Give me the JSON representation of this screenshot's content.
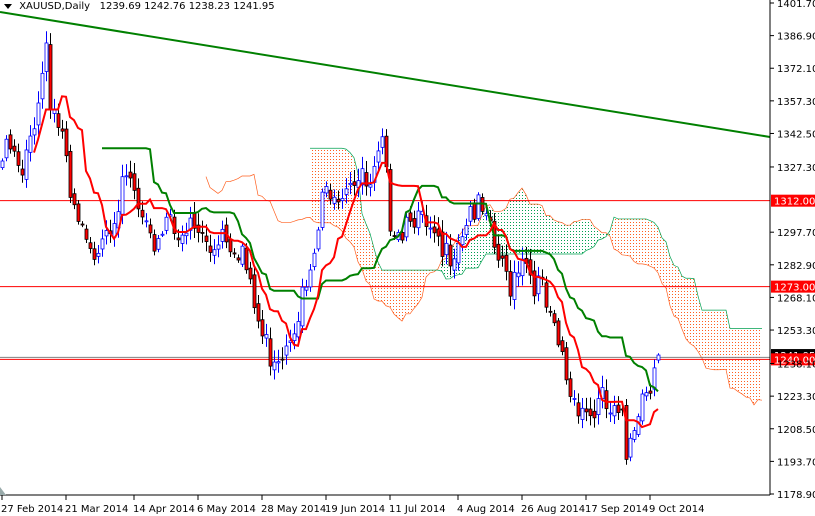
{
  "header": {
    "symbol": "XAUUSD,Daily",
    "open": "1239.69",
    "high": "1242.76",
    "low": "1238.23",
    "close": "1241.95"
  },
  "chart_data": {
    "type": "candlestick",
    "title": "XAUUSD,Daily",
    "ylim": [
      1178.9,
      1401.7
    ],
    "y_ticks": [
      "1401.70",
      "1386.90",
      "1372.10",
      "1357.30",
      "1342.50",
      "1327.30",
      "1312.00",
      "1297.70",
      "1282.90",
      "1273.00",
      "1268.10",
      "1253.30",
      "1241.95",
      "1240.00",
      "1238.10",
      "1223.30",
      "1208.50",
      "1193.70",
      "1178.90"
    ],
    "x_ticks": [
      {
        "bar": 0,
        "label": "27 Feb 2014"
      },
      {
        "bar": 16,
        "label": "21 Mar 2014"
      },
      {
        "bar": 33,
        "label": "14 Apr 2014"
      },
      {
        "bar": 49,
        "label": "6 May 2014"
      },
      {
        "bar": 65,
        "label": "28 May 2014"
      },
      {
        "bar": 81,
        "label": "19 Jun 2014"
      },
      {
        "bar": 97,
        "label": "11 Jul 2014"
      },
      {
        "bar": 114,
        "label": "4 Aug 2014"
      },
      {
        "bar": 130,
        "label": "26 Aug 2014"
      },
      {
        "bar": 146,
        "label": "17 Sep 2014"
      },
      {
        "bar": 162,
        "label": "9 Oct 2014"
      }
    ],
    "close_keyframes": [
      [
        0,
        1330
      ],
      [
        2,
        1335
      ],
      [
        5,
        1320
      ],
      [
        7,
        1340
      ],
      [
        10,
        1370
      ],
      [
        11,
        1385
      ],
      [
        12,
        1360
      ],
      [
        15,
        1340
      ],
      [
        17,
        1310
      ],
      [
        20,
        1295
      ],
      [
        22,
        1285
      ],
      [
        25,
        1300
      ],
      [
        27,
        1305
      ],
      [
        30,
        1315
      ],
      [
        32,
        1320
      ],
      [
        35,
        1300
      ],
      [
        37,
        1290
      ],
      [
        40,
        1300
      ],
      [
        42,
        1310
      ],
      [
        45,
        1290
      ],
      [
        47,
        1300
      ],
      [
        50,
        1295
      ],
      [
        52,
        1290
      ],
      [
        55,
        1300
      ],
      [
        57,
        1295
      ],
      [
        60,
        1290
      ],
      [
        62,
        1270
      ],
      [
        65,
        1250
      ],
      [
        67,
        1243
      ],
      [
        70,
        1245
      ],
      [
        72,
        1255
      ],
      [
        75,
        1268
      ],
      [
        77,
        1275
      ],
      [
        80,
        1310
      ],
      [
        82,
        1320
      ],
      [
        85,
        1318
      ],
      [
        87,
        1325
      ],
      [
        90,
        1320
      ],
      [
        92,
        1315
      ],
      [
        95,
        1335
      ],
      [
        97,
        1305
      ],
      [
        100,
        1300
      ],
      [
        102,
        1310
      ],
      [
        105,
        1300
      ],
      [
        107,
        1295
      ],
      [
        110,
        1285
      ],
      [
        112,
        1290
      ],
      [
        115,
        1300
      ],
      [
        117,
        1310
      ],
      [
        120,
        1305
      ],
      [
        122,
        1295
      ],
      [
        125,
        1280
      ],
      [
        127,
        1275
      ],
      [
        130,
        1290
      ],
      [
        132,
        1280
      ],
      [
        135,
        1270
      ],
      [
        137,
        1255
      ],
      [
        140,
        1240
      ],
      [
        142,
        1225
      ],
      [
        145,
        1220
      ],
      [
        147,
        1215
      ],
      [
        150,
        1220
      ],
      [
        152,
        1215
      ],
      [
        155,
        1210
      ],
      [
        156,
        1195
      ],
      [
        157,
        1208
      ],
      [
        160,
        1225
      ],
      [
        162,
        1232
      ],
      [
        163,
        1240
      ],
      [
        164,
        1241.95
      ]
    ],
    "indicators": {
      "ichimoku": {
        "tenkan": 9,
        "kijun": 26,
        "senkou_b": 52,
        "tenkan_color": "#ff0000",
        "kijun_color": "#008000",
        "cloud_up_color": "#00a050",
        "cloud_down_color": "#ff6020"
      },
      "trendline": {
        "start_price": 1397.6,
        "end_price": 1340.9,
        "color": "#008000"
      },
      "horizontal_lines": [
        {
          "price": 1312.0,
          "label": "1312.00",
          "color": "#ff0000"
        },
        {
          "price": 1273.0,
          "label": "1273.00",
          "color": "#ff0000"
        },
        {
          "price": 1240.0,
          "label": "1240.00",
          "color": "#ff0000"
        }
      ],
      "bid": {
        "price": 1241.95,
        "label": "1241.95"
      }
    },
    "colors": {
      "bull_outline": "#0000ff",
      "bull_body": "#ffffff",
      "bear_outline": "#000000",
      "bear_body": "#ff0000"
    }
  }
}
